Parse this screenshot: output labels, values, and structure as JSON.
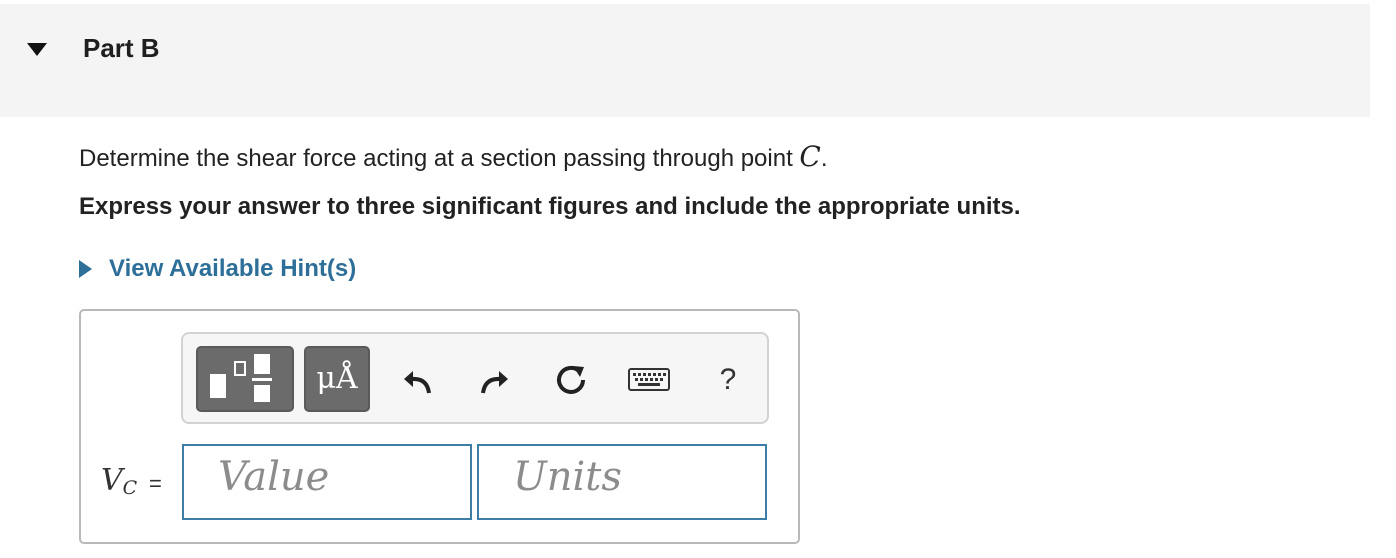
{
  "part": {
    "title": "Part B",
    "expanded": true
  },
  "question": {
    "text": "Determine the shear force acting at a section passing through point ",
    "variable": "C",
    "suffix": "."
  },
  "instruction": "Express your answer to three significant figures and include the appropriate units.",
  "hint": {
    "label": "View Available Hint(s)"
  },
  "toolbar": {
    "units_label": "μÅ",
    "help_label": "?",
    "icons": [
      "templates-icon",
      "units-icon",
      "undo-icon",
      "redo-icon",
      "reset-icon",
      "keyboard-icon",
      "help-icon"
    ]
  },
  "answer": {
    "variable": "V",
    "subscript": "C",
    "equals": "=",
    "value_placeholder": "Value",
    "units_placeholder": "Units"
  },
  "colors": {
    "header_bg": "#f4f4f4",
    "link": "#2d6f99",
    "input_border": "#3d7ea6",
    "toolbar_button": "#6b6b6b"
  }
}
